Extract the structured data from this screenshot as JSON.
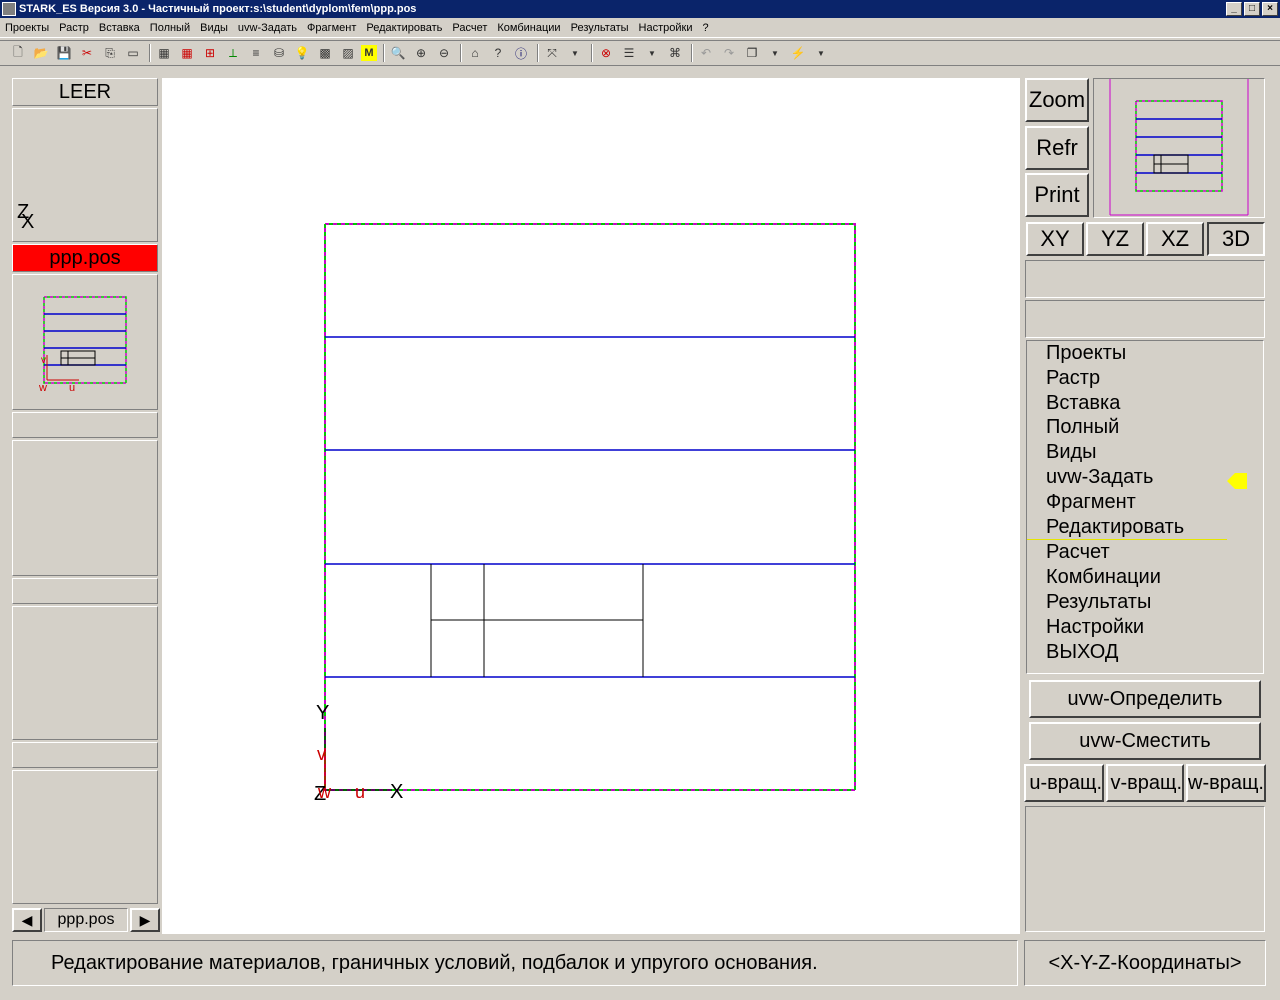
{
  "window": {
    "title": "STARK_ES Версия 3.0 - Частичный проект:s:\\student\\dyplom\\fem\\ppp.pos"
  },
  "menu": [
    "Проекты",
    "Растр",
    "Вставка",
    "Полный",
    "Виды",
    "uvw-Задать",
    "Фрагмент",
    "Редактировать",
    "Расчет",
    "Комбинации",
    "Результаты",
    "Настройки",
    "?"
  ],
  "left_panel": {
    "header": "LEER",
    "axis_label_z": "Z",
    "axis_label_y": "Y",
    "axis_label_x": "X",
    "active_file": "ppp.pos",
    "thumb_labels": {
      "v": "v",
      "w": "w",
      "u": "u"
    },
    "nav": {
      "prev": "◀",
      "file": "ppp.pos",
      "next": "▶"
    }
  },
  "canvas": {
    "axes": {
      "Y": "Y",
      "v": "v",
      "Z": "Z",
      "w": "w",
      "u": "u",
      "X": "X"
    }
  },
  "right_panel": {
    "zoom_label": "Zoom",
    "refr_label": "Refr",
    "print_label": "Print",
    "views": [
      "XY",
      "YZ",
      "XZ",
      "3D"
    ],
    "menu_items": [
      "Проекты",
      "Растр",
      "Вставка",
      "Полный",
      "Виды",
      "uvw-Задать",
      "Фрагмент",
      "Редактировать",
      "Расчет",
      "Комбинации",
      "Результаты",
      "Настройки",
      "ВЫХОД"
    ],
    "selected_index": 7,
    "uvw_define": "uvw-Определить",
    "uvw_shift": "uvw-Сместить",
    "rot": [
      "u-вращ.",
      "v-вращ.",
      "w-вращ."
    ]
  },
  "status": {
    "message": "Редактирование материалов, граничных условий, подбалок и упругого основания.",
    "coords": "<X-Y-Z-Координаты>"
  },
  "colors": {
    "accent_red": "#ff0000",
    "line_blue": "#0000cc",
    "border_magenta": "#cc00cc",
    "border_green": "#00cc00",
    "pointer_yellow": "#ffff00"
  }
}
